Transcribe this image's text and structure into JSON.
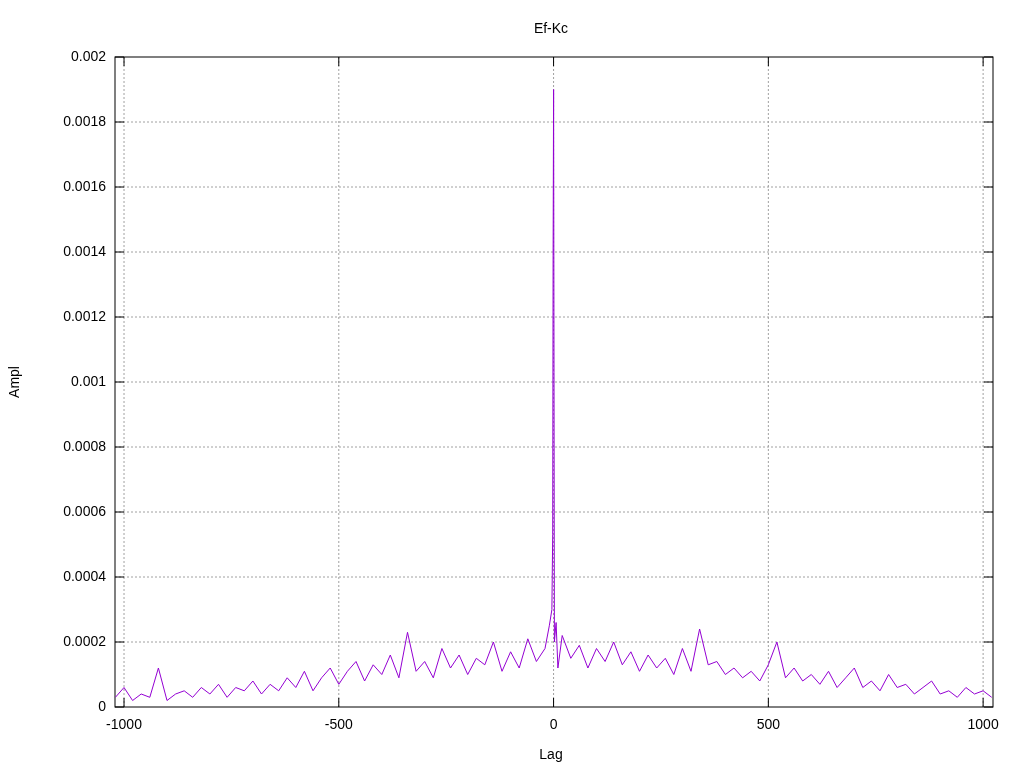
{
  "chart": {
    "chart_data": {
      "type": "line",
      "title": "Ef-Kc",
      "xlabel": "Lag",
      "ylabel": "Ampl",
      "grid": true,
      "xlim": [
        -1021,
        1023
      ],
      "ylim": [
        0,
        0.002
      ],
      "xticks": [
        -1000,
        -500,
        0,
        500,
        1000
      ],
      "yticks": [
        {
          "value": 0,
          "label": "0"
        },
        {
          "value": 0.0002,
          "label": "0.0002"
        },
        {
          "value": 0.0004,
          "label": "0.0004"
        },
        {
          "value": 0.0006,
          "label": "0.0006"
        },
        {
          "value": 0.0008,
          "label": "0.0008"
        },
        {
          "value": 0.001,
          "label": "0.001"
        },
        {
          "value": 0.0012,
          "label": "0.0012"
        },
        {
          "value": 0.0014,
          "label": "0.0014"
        },
        {
          "value": 0.0016,
          "label": "0.0016"
        },
        {
          "value": 0.0018,
          "label": "0.0018"
        },
        {
          "value": 0.002,
          "label": "0.002"
        }
      ],
      "x": [
        -1020,
        -1000,
        -980,
        -960,
        -940,
        -920,
        -900,
        -880,
        -860,
        -840,
        -820,
        -800,
        -780,
        -760,
        -740,
        -720,
        -700,
        -680,
        -660,
        -640,
        -620,
        -600,
        -580,
        -560,
        -540,
        -520,
        -500,
        -480,
        -460,
        -440,
        -420,
        -400,
        -380,
        -360,
        -340,
        -320,
        -300,
        -280,
        -260,
        -240,
        -220,
        -200,
        -180,
        -160,
        -140,
        -120,
        -100,
        -80,
        -60,
        -40,
        -20,
        -10,
        -4,
        -2,
        -1,
        0,
        1,
        2,
        6,
        10,
        20,
        40,
        60,
        80,
        100,
        120,
        140,
        160,
        180,
        200,
        220,
        240,
        260,
        280,
        300,
        320,
        340,
        360,
        380,
        400,
        420,
        440,
        460,
        480,
        500,
        520,
        540,
        560,
        580,
        600,
        620,
        640,
        660,
        680,
        700,
        720,
        740,
        760,
        780,
        800,
        820,
        840,
        860,
        880,
        900,
        920,
        940,
        960,
        980,
        1000,
        1020
      ],
      "series": [
        {
          "color": "#9400d3",
          "values": [
            3e-05,
            6e-05,
            2e-05,
            4e-05,
            3e-05,
            0.00012,
            2e-05,
            4e-05,
            5e-05,
            3e-05,
            6e-05,
            4e-05,
            7e-05,
            3e-05,
            6e-05,
            5e-05,
            8e-05,
            4e-05,
            7e-05,
            5e-05,
            9e-05,
            6e-05,
            0.00011,
            5e-05,
            9e-05,
            0.00012,
            7e-05,
            0.00011,
            0.00014,
            8e-05,
            0.00013,
            0.0001,
            0.00016,
            9e-05,
            0.00023,
            0.00011,
            0.00014,
            9e-05,
            0.00018,
            0.00012,
            0.00016,
            0.0001,
            0.00015,
            0.00013,
            0.0002,
            0.00011,
            0.00017,
            0.00012,
            0.00021,
            0.00014,
            0.00018,
            0.00025,
            0.0003,
            0.00053,
            0.00139,
            0.0019,
            0.00103,
            0.0002,
            0.00026,
            0.00012,
            0.00022,
            0.00015,
            0.00019,
            0.00012,
            0.00018,
            0.00014,
            0.0002,
            0.00013,
            0.00017,
            0.00011,
            0.00016,
            0.00012,
            0.00015,
            0.0001,
            0.00018,
            0.00011,
            0.00024,
            0.00013,
            0.00014,
            0.0001,
            0.00012,
            9e-05,
            0.00011,
            8e-05,
            0.00013,
            0.0002,
            9e-05,
            0.00012,
            8e-05,
            0.0001,
            7e-05,
            0.00011,
            6e-05,
            9e-05,
            0.00012,
            6e-05,
            8e-05,
            5e-05,
            0.0001,
            6e-05,
            7e-05,
            4e-05,
            6e-05,
            8e-05,
            4e-05,
            5e-05,
            3e-05,
            6e-05,
            4e-05,
            5e-05,
            3e-05
          ]
        }
      ]
    }
  }
}
